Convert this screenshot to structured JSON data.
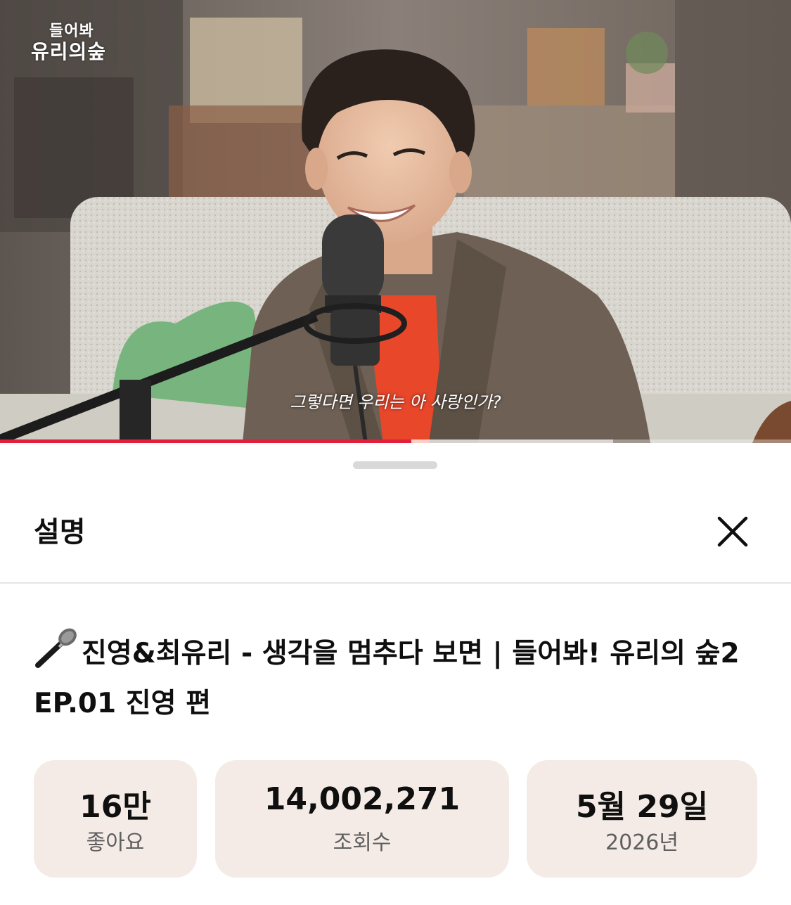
{
  "player": {
    "channel_logo_line1": "들어봐",
    "channel_logo_line2": "유리의숲",
    "subtitle": "그렇다면 우리는 아 사랑인가?",
    "progress_fraction": 0.52,
    "buffered_fraction": 0.775,
    "colors": {
      "progress": "#e3203b"
    }
  },
  "sheet": {
    "title": "설명",
    "close_icon": "close-icon",
    "video_title_emoji": "microphone-icon",
    "video_title": "진영&최유리 - 생각을 멈추다 보면 | 들어봐! 유리의 숲2 EP.01 진영 편",
    "stats": [
      {
        "value": "16만",
        "label": "좋아요"
      },
      {
        "value": "14,002,271",
        "label": "조회수"
      },
      {
        "value": "5월 29일",
        "label": "2026년"
      }
    ],
    "colors": {
      "stat_background": "#f4ebe6"
    }
  }
}
